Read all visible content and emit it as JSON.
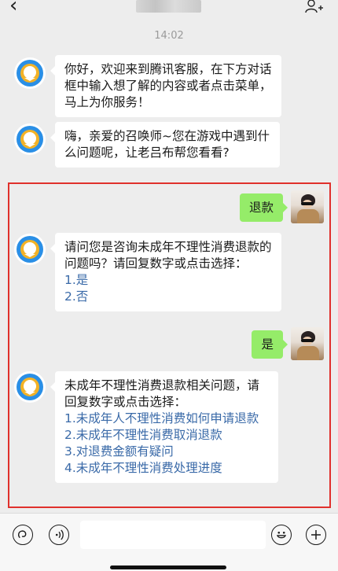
{
  "header": {
    "back_icon": "chevron-left-icon",
    "contact_icon": "add-person-icon"
  },
  "timestamp": "14:02",
  "messages": [
    {
      "from": "bot",
      "text": "你好，欢迎来到腾讯客服，在下方对话框中输入想了解的内容或者点击菜单，马上为你服务！"
    },
    {
      "from": "bot",
      "text": "嗨，亲爱的召唤师~您在游戏中遇到什么问题呢，让老吕布帮您看看?"
    },
    {
      "from": "user",
      "text": "退款"
    },
    {
      "from": "bot",
      "text": "请问您是咨询未成年不理性消费退款的问题吗？请回复数字或点击选择：",
      "options": [
        "1.是",
        "2.否"
      ]
    },
    {
      "from": "user",
      "text": "是"
    },
    {
      "from": "bot",
      "text": "未成年不理性消费退款相关问题，请回复数字或点击选择：",
      "options": [
        "1.未成年人不理性消费如何申请退款",
        "2.未成年不理性消费取消退款",
        "3.对退费金额有疑问",
        "4.未成年不理性消费处理进度"
      ]
    }
  ],
  "colors": {
    "user_bubble": "#95ec69",
    "bot_bubble": "#ffffff",
    "option_link": "#3a6aa8",
    "highlight_border": "#e0312c",
    "background": "#ededed"
  },
  "input_bar": {
    "voice_icon": "voice-icon",
    "audio_icon": "audio-wave-icon",
    "emoji_icon": "emoji-icon",
    "add_icon": "plus-icon"
  }
}
